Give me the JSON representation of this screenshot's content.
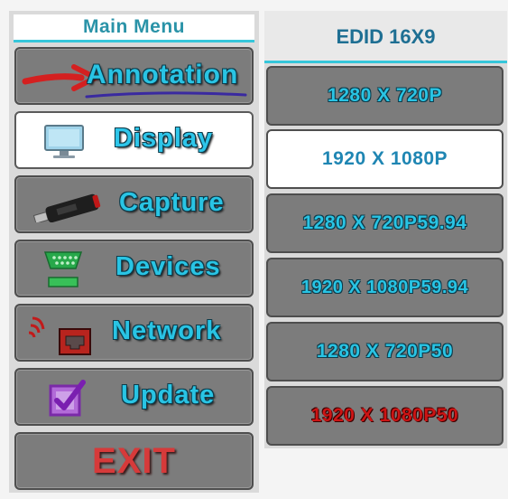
{
  "menu": {
    "title": "Main Menu",
    "items": [
      {
        "label": "Annotation",
        "icon": "arrow-icon"
      },
      {
        "label": "Display",
        "icon": "monitor-icon",
        "active": true
      },
      {
        "label": "Capture",
        "icon": "usb-stick-icon"
      },
      {
        "label": "Devices",
        "icon": "serial-port-icon"
      },
      {
        "label": "Network",
        "icon": "network-port-icon"
      },
      {
        "label": "Update",
        "icon": "checkbox-icon"
      }
    ],
    "exit_label": "EXIT"
  },
  "edid": {
    "title": "EDID 16X9",
    "options": [
      {
        "label": "1280 X 720P"
      },
      {
        "label": "1920 X 1080P",
        "selected": true
      },
      {
        "label": "1280 X 720P59.94"
      },
      {
        "label": "1920 X 1080P59.94"
      },
      {
        "label": "1280 X 720P50"
      },
      {
        "label": "1920 X 1080P50",
        "color": "#cc1414"
      }
    ]
  },
  "colors": {
    "accent": "#36c6da",
    "label": "#29c4e4",
    "button": "#7c7c7c",
    "exit": "#d63a3a"
  }
}
